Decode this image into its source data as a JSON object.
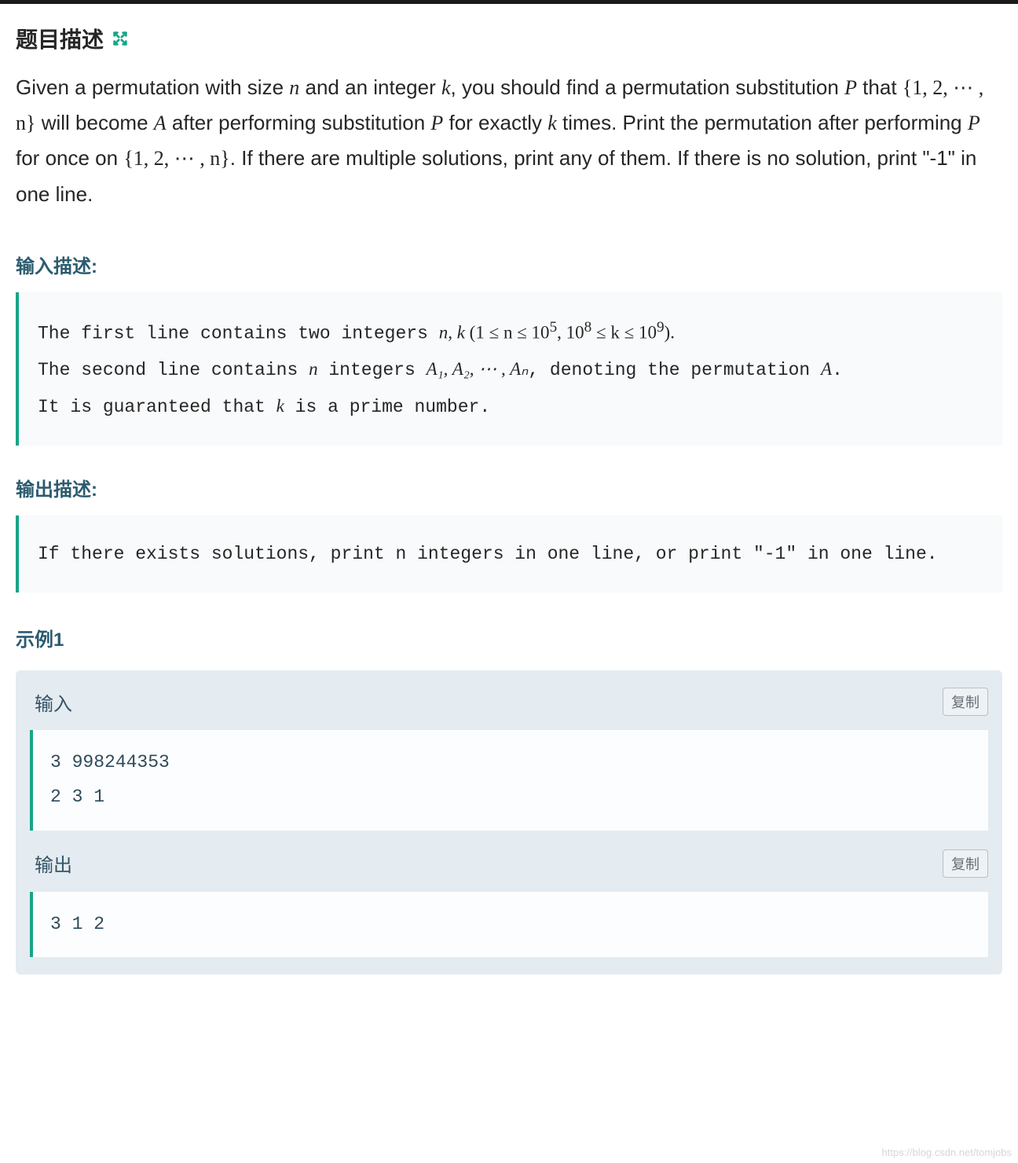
{
  "title": "题目描述",
  "problem": {
    "p1_a": "Given a permutation with size ",
    "p1_b": " and an integer ",
    "p1_c": ", you should find a permutation substitution ",
    "p1_d": " that ",
    "p1_e": " will become ",
    "p1_f": " after performing substitution ",
    "p1_g": " for exactly ",
    "p1_h": " times. Print the permutation after performing ",
    "p1_i": " for once on ",
    "p1_j": ". If there are multiple solutions, print any of them. If there is no solution, print \"-1\" in one line.",
    "sym_n": "n",
    "sym_k": "k",
    "sym_P": "P",
    "sym_A": "A",
    "set_1n": "{1, 2, ⋯ , n}"
  },
  "input_label": "输入描述:",
  "input_desc": {
    "l1_a": "The first line contains two integers ",
    "l1_nk": "n, k",
    "l1_b": " (1 ≤ n ≤ 10",
    "l1_e5": "5",
    "l1_c": ", 10",
    "l1_e8": "8",
    "l1_d": " ≤ k ≤ 10",
    "l1_e9": "9",
    "l1_e": ").",
    "l2_a": "The second line contains ",
    "l2_b": " integers ",
    "l2_seq": "A₁, A₂, ⋯ , Aₙ",
    "l2_c": ", denoting the permutation ",
    "l2_d": ".",
    "l3_a": "It is guaranteed that ",
    "l3_b": " is a prime number."
  },
  "output_label": "输出描述:",
  "output_desc": "If there exists solutions, print n integers in one line, or print \"-1\" in one line.",
  "example_label": "示例1",
  "example": {
    "input_label": "输入",
    "output_label": "输出",
    "copy_label": "复制",
    "input": "3 998244353\n2 3 1",
    "output": "3 1 2"
  },
  "watermark": "https://blog.csdn.net/tomjobs"
}
